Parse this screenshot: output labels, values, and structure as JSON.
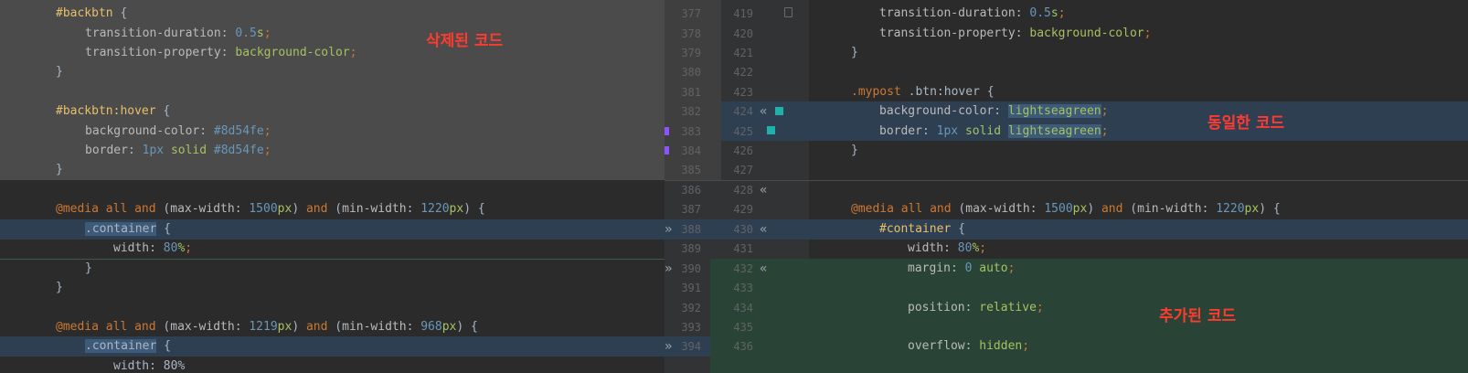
{
  "annotations": {
    "deleted": "삭제된 코드",
    "same": "동일한 코드",
    "added": "추가된 코드"
  },
  "left_gutter_numbers": [
    "377",
    "378",
    "379",
    "380",
    "381",
    "382",
    "383",
    "384",
    "385",
    "386",
    "387",
    "388",
    "389",
    "390",
    "391",
    "392",
    "393",
    "394"
  ],
  "right_gutter_numbers": [
    "419",
    "420",
    "421",
    "422",
    "423",
    "424",
    "425",
    "426",
    "427",
    "428",
    "429",
    "430",
    "431",
    "432",
    "433",
    "434",
    "435",
    "436"
  ],
  "left_code": {
    "l1_sel": "#backbtn",
    "l2_prop": "transition-duration",
    "l2_num": "0.5",
    "l2_unit": "s",
    "l3_prop": "transition-property",
    "l3_val": "background-color",
    "l6_sel": "#backbtn:hover",
    "l7_prop": "background-color",
    "l7_val": "#8d54fe",
    "l8_prop": "border",
    "l8_num": "1px",
    "l8_val1": "solid",
    "l8_val2": "#8d54fe",
    "l10_media": "@media",
    "l10_all": "all",
    "l10_and1": "and",
    "l10_p1": "max-width",
    "l10_n1": "1500",
    "l10_u1": "px",
    "l10_and2": "and",
    "l10_p2": "min-width",
    "l10_n2": "1220",
    "l10_u2": "px",
    "l11_sel": ".container",
    "l12_prop": "width",
    "l12_num": "80",
    "l12_unit": "%",
    "l16_media": "@media",
    "l16_all": "all",
    "l16_and1": "and",
    "l16_p1": "max-width",
    "l16_n1": "1219",
    "l16_u1": "px",
    "l16_and2": "and",
    "l16_p2": "min-width",
    "l16_n2": "968",
    "l16_u2": "px",
    "l17_sel": ".container",
    "l18_partial": "width: 80%"
  },
  "right_code": {
    "r1_prop": "transition-duration",
    "r1_num": "0.5",
    "r1_unit": "s",
    "r2_prop": "transition-property",
    "r2_val": "background-color",
    "r5_sel1": ".mypost",
    "r5_sel2": ".btn:hover",
    "r6_prop": "background-color",
    "r6_val": "lightseagreen",
    "r7_prop": "border",
    "r7_num": "1px",
    "r7_val1": "solid",
    "r7_val2": "lightseagreen",
    "r10_media": "@media",
    "r10_all": "all",
    "r10_and1": "and",
    "r10_p1": "max-width",
    "r10_n1": "1500",
    "r10_u1": "px",
    "r10_and2": "and",
    "r10_p2": "min-width",
    "r10_n2": "1220",
    "r10_u2": "px",
    "r11_sel": "#container",
    "r12_prop": "width",
    "r12_num": "80",
    "r12_unit": "%",
    "r13_prop": "margin",
    "r13_num": "0",
    "r13_val": "auto",
    "r15_prop": "position",
    "r15_val": "relative",
    "r17_prop": "overflow",
    "r17_val": "hidden"
  },
  "colors": {
    "background": "#2b2b2b",
    "deleted_bg": "#4b4b4b",
    "modified_bg": "#2f3f52",
    "added_bg": "#294436",
    "annotation": "#ff3b30",
    "purple_marker": "#8d54fe",
    "teal_marker": "#20b2aa"
  },
  "icons": [
    "merge-left-arrow-icon",
    "merge-right-arrow-icon",
    "fold-icon"
  ]
}
